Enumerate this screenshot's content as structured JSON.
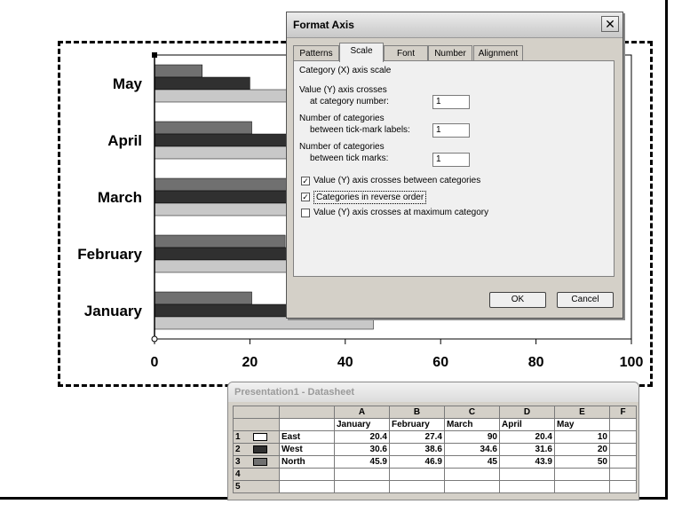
{
  "chart_data": {
    "type": "bar",
    "orientation": "horizontal",
    "categories": [
      "January",
      "February",
      "March",
      "April",
      "May"
    ],
    "series": [
      {
        "values": [
          20.4,
          27.4,
          90,
          20.4,
          10
        ],
        "color": "#707070"
      },
      {
        "values": [
          30.6,
          38.6,
          34.6,
          31.6,
          20
        ],
        "color": "#303030"
      },
      {
        "values": [
          45.9,
          46.9,
          45,
          43.9,
          50
        ],
        "color": "#c8c8c8"
      }
    ],
    "xlim": [
      0,
      100
    ],
    "ticks": [
      "0",
      "20",
      "40",
      "60",
      "80",
      "100"
    ],
    "reverse_categories": true
  },
  "dialog": {
    "title": "Format Axis",
    "close": "✕",
    "tabs": [
      "Patterns",
      "Scale",
      "Font",
      "Number",
      "Alignment"
    ],
    "active_tab": "Scale",
    "heading": "Category (X) axis scale",
    "crosses_label_1": "Value (Y) axis crosses",
    "crosses_label_2": "at category number:",
    "crosses_value": "1",
    "labels_label_1": "Number of categories",
    "labels_label_2": "between tick-mark labels:",
    "labels_value": "1",
    "marks_label_1": "Number of categories",
    "marks_label_2": "between tick marks:",
    "marks_value": "1",
    "checkboxes": [
      {
        "label": "Value (Y) axis crosses between categories",
        "checked": true
      },
      {
        "label": "Categories in reverse order",
        "checked": true
      },
      {
        "label": "Value (Y) axis crosses at maximum category",
        "checked": false
      }
    ],
    "ok": "OK",
    "cancel": "Cancel"
  },
  "datasheet": {
    "title": "Presentation1 - Datasheet",
    "columns": [
      "A",
      "B",
      "C",
      "D",
      "E",
      "F"
    ],
    "headers": [
      "January",
      "February",
      "March",
      "April",
      "May"
    ],
    "rows": [
      {
        "num": "1",
        "name": "East",
        "values": [
          "20.4",
          "27.4",
          "90",
          "20.4",
          "10"
        ],
        "icon_color": "#ffffff"
      },
      {
        "num": "2",
        "name": "West",
        "values": [
          "30.6",
          "38.6",
          "34.6",
          "31.6",
          "20"
        ],
        "icon_color": "#303030"
      },
      {
        "num": "3",
        "name": "North",
        "values": [
          "45.9",
          "46.9",
          "45",
          "43.9",
          "50"
        ],
        "icon_color": "#707070"
      },
      {
        "num": "4",
        "name": "",
        "values": [
          "",
          "",
          "",
          "",
          ""
        ]
      },
      {
        "num": "5",
        "name": "",
        "values": [
          "",
          "",
          "",
          "",
          ""
        ]
      }
    ]
  }
}
